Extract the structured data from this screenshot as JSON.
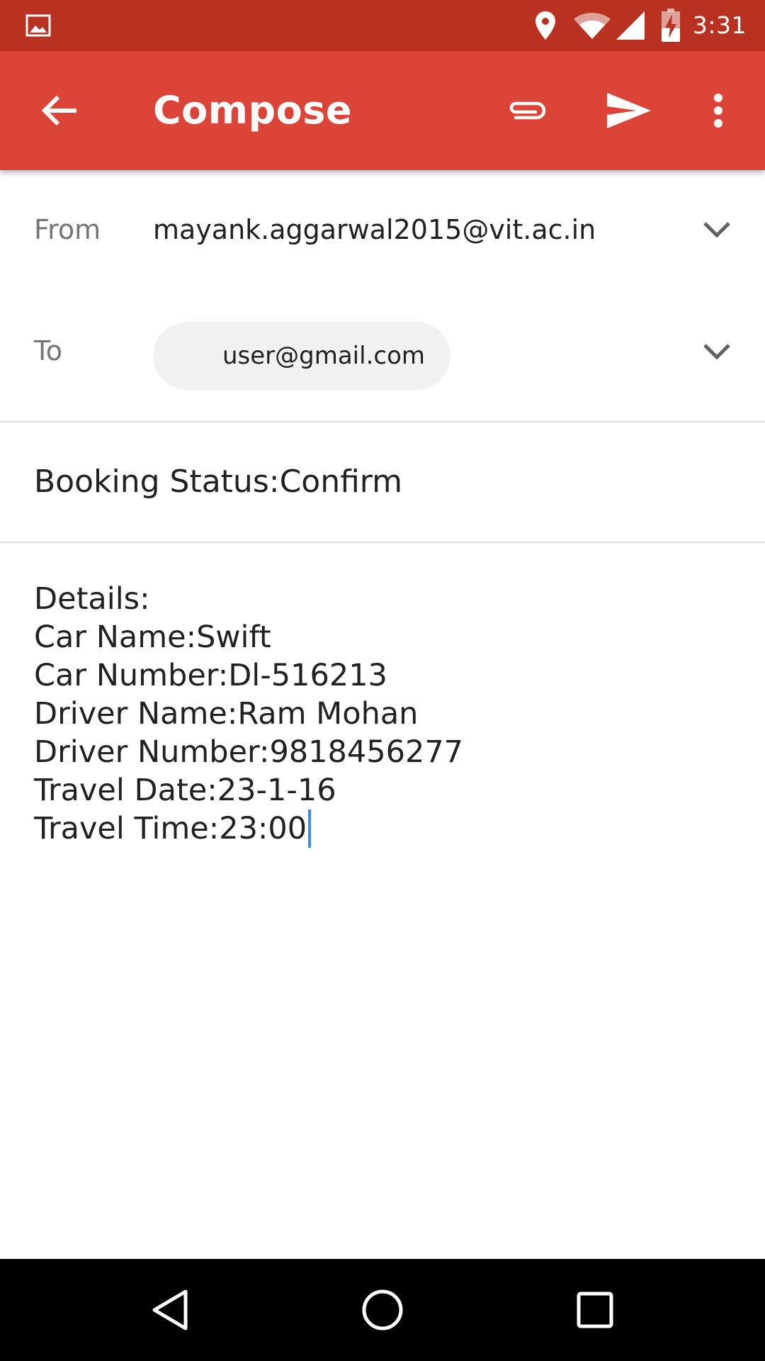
{
  "status_bar": {
    "time": "3:31",
    "icons": [
      "image-notification-icon",
      "location-icon",
      "wifi-icon",
      "cell-signal-icon",
      "battery-charging-icon"
    ]
  },
  "app_bar": {
    "title": "Compose",
    "icons": [
      "back-arrow-icon",
      "attach-icon",
      "send-icon",
      "more-vert-icon"
    ]
  },
  "from": {
    "label": "From",
    "value": "mayank.aggarwal2015@vit.ac.in"
  },
  "to": {
    "label": "To",
    "recipient": "user@gmail.com"
  },
  "subject": "Booking Status:Confirm",
  "body": {
    "lines": [
      "Details:",
      "Car Name:Swift",
      "Car Number:Dl-516213",
      "Driver Name:Ram Mohan",
      "Driver Number:9818456277",
      "Travel Date:23-1-16",
      "Travel Time:23:00"
    ]
  },
  "nav_bar": {
    "icons": [
      "back-nav-icon",
      "home-nav-icon",
      "recents-nav-icon"
    ]
  },
  "colors": {
    "status_bar": "#B93221",
    "app_bar": "#DB4437",
    "cursor": "#4285F4"
  }
}
